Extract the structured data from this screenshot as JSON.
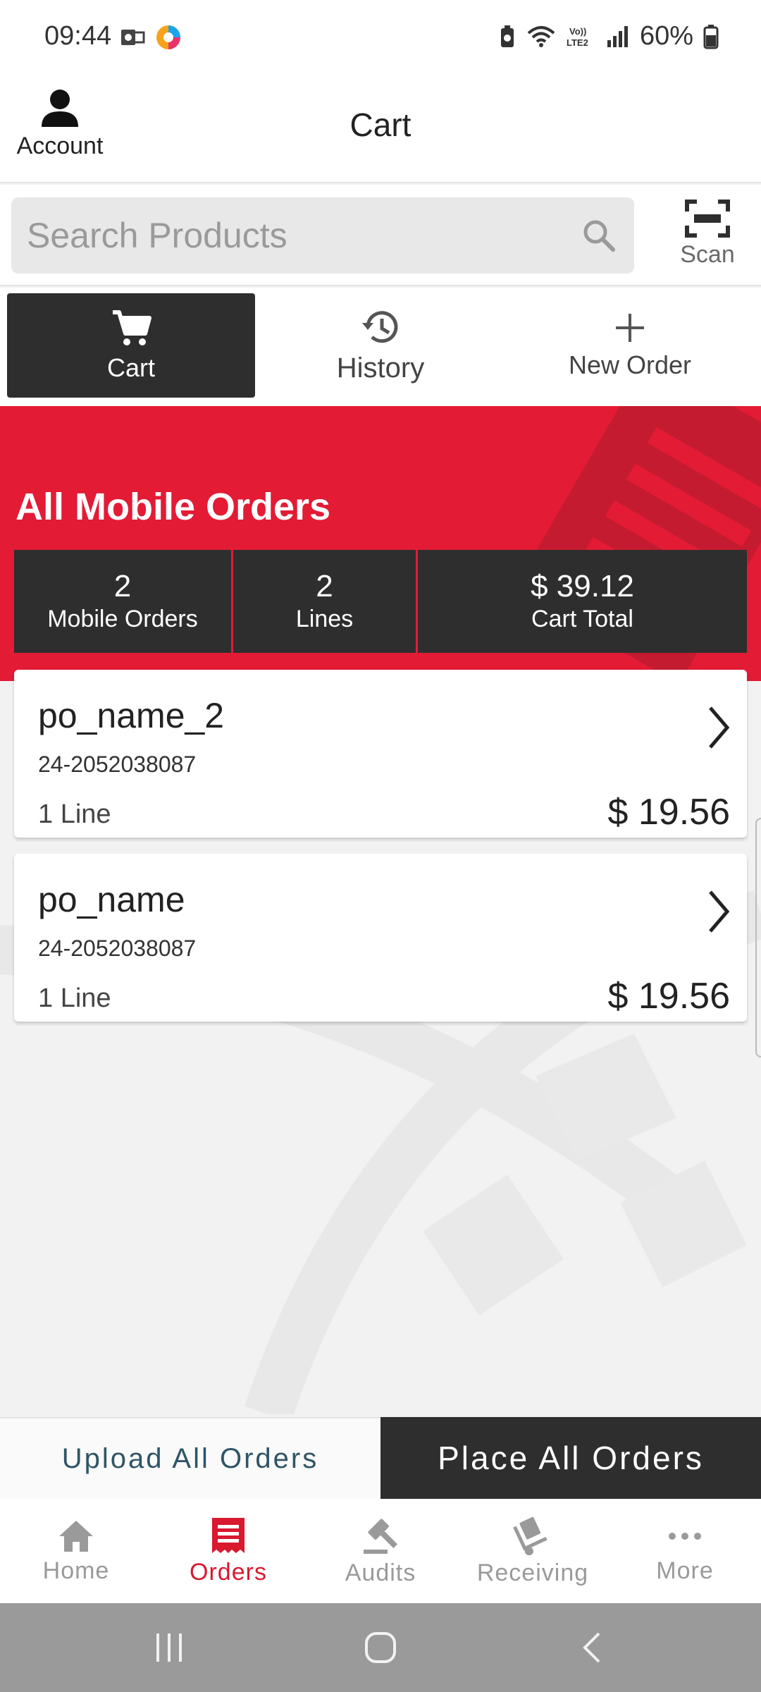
{
  "status_bar": {
    "time": "09:44",
    "battery": "60%",
    "icons": [
      "outlook-icon",
      "app-icon",
      "battery-saver-icon",
      "wifi-icon",
      "volte-icon",
      "signal-icon",
      "battery-icon"
    ]
  },
  "header": {
    "account_label": "Account",
    "title": "Cart"
  },
  "search": {
    "placeholder": "Search Products",
    "scan_label": "Scan"
  },
  "tabs": [
    {
      "label": "Cart",
      "icon": "cart-icon",
      "active": true
    },
    {
      "label": "History",
      "icon": "history-icon",
      "active": false
    },
    {
      "label": "New Order",
      "icon": "plus-icon",
      "active": false
    }
  ],
  "banner": {
    "title": "All Mobile Orders",
    "stats": [
      {
        "value": "2",
        "label": "Mobile Orders"
      },
      {
        "value": "2",
        "label": "Lines"
      },
      {
        "value": "$ 39.12",
        "label": "Cart Total"
      }
    ]
  },
  "orders": [
    {
      "name": "po_name_2",
      "number": "24-2052038087",
      "lines": "1 Line",
      "total": "$ 19.56"
    },
    {
      "name": "po_name",
      "number": "24-2052038087",
      "lines": "1 Line",
      "total": "$ 19.56"
    }
  ],
  "actions": {
    "upload_label": "Upload All Orders",
    "place_label": "Place All Orders"
  },
  "bottom_nav": [
    {
      "label": "Home",
      "icon": "home-icon",
      "active": false
    },
    {
      "label": "Orders",
      "icon": "orders-icon",
      "active": true
    },
    {
      "label": "Audits",
      "icon": "gavel-icon",
      "active": false
    },
    {
      "label": "Receiving",
      "icon": "dolly-icon",
      "active": false
    },
    {
      "label": "More",
      "icon": "more-icon",
      "active": false
    }
  ],
  "colors": {
    "brand_red": "#e31b35",
    "dark": "#2e2e2e",
    "active_nav": "#d8192f"
  }
}
